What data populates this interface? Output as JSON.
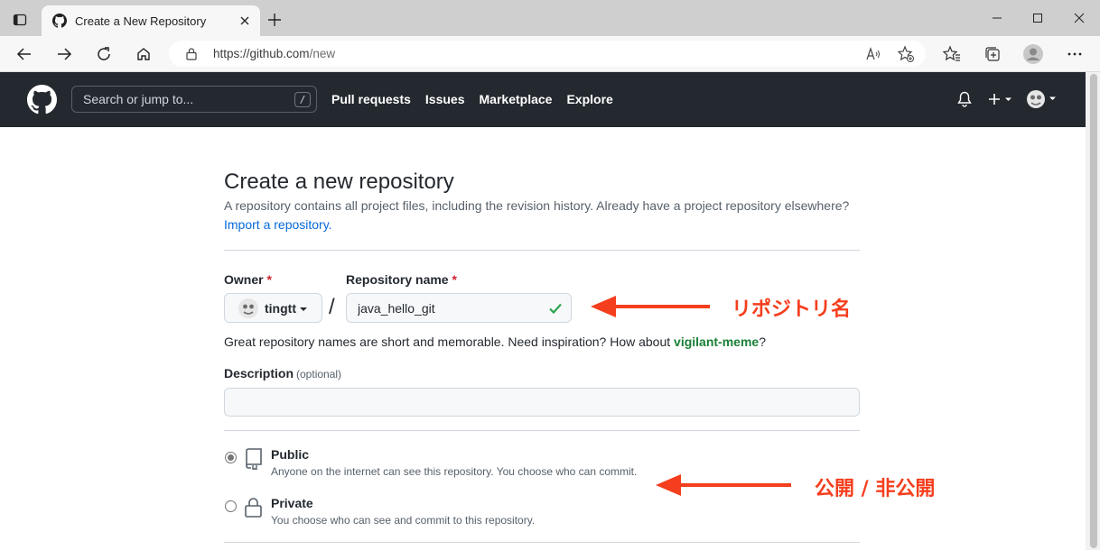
{
  "browser": {
    "tab_title": "Create a New Repository",
    "url_host": "https://github.com",
    "url_path": "/new"
  },
  "header": {
    "search_placeholder": "Search or jump to...",
    "search_shortcut": "/",
    "nav": [
      "Pull requests",
      "Issues",
      "Marketplace",
      "Explore"
    ]
  },
  "form": {
    "title": "Create a new repository",
    "description": "A repository contains all project files, including the revision history. Already have a project repository elsewhere?",
    "import_link": "Import a repository.",
    "owner_label": "Owner",
    "owner_value": "tingtt",
    "slash": "/",
    "repo_label": "Repository name",
    "required_mark": "*",
    "repo_value": "java_hello_git",
    "hint_prefix": "Great repository names are short and memorable. Need inspiration? How about ",
    "hint_suggestion": "vigilant-meme",
    "hint_suffix": "?",
    "description_label": "Description",
    "description_optional": "(optional)",
    "description_value": "",
    "visibility": {
      "selected": "Public",
      "options": [
        {
          "title": "Public",
          "subtitle": "Anyone on the internet can see this repository. You choose who can commit."
        },
        {
          "title": "Private",
          "subtitle": "You choose who can see and commit to this repository."
        }
      ]
    }
  },
  "annotations": {
    "repo_name_note": "リポジトリ名",
    "visibility_note": "公開 / 非公開",
    "color": "#f53e1d"
  }
}
